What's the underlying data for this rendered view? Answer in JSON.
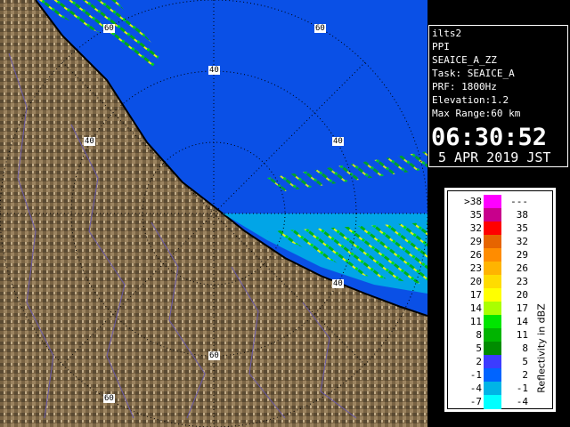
{
  "info": {
    "lines": [
      "ilts2",
      "PPI",
      "SEAICE_A_ZZ",
      "Task: SEAICE_A",
      "PRF: 1800Hz",
      "Elevation:1.2",
      "Max Range:60 km"
    ],
    "time": "06:30:52",
    "date": "5 APR 2019 JST"
  },
  "rings": {
    "labels": [
      "40",
      "40",
      "40",
      "40",
      "60",
      "60",
      "60",
      "60"
    ]
  },
  "legend": {
    "title": "Reflectivity in dBZ",
    "rows": [
      {
        "lo": ">38",
        "hi": "---",
        "color": "#ff00ff"
      },
      {
        "lo": "35",
        "hi": "38",
        "color": "#c8008c"
      },
      {
        "lo": "32",
        "hi": "35",
        "color": "#ff0000"
      },
      {
        "lo": "29",
        "hi": "32",
        "color": "#e66400"
      },
      {
        "lo": "26",
        "hi": "29",
        "color": "#ff8c00"
      },
      {
        "lo": "23",
        "hi": "26",
        "color": "#ffb400"
      },
      {
        "lo": "20",
        "hi": "23",
        "color": "#ffdc00"
      },
      {
        "lo": "17",
        "hi": "20",
        "color": "#ffff00"
      },
      {
        "lo": "14",
        "hi": "17",
        "color": "#aaff00"
      },
      {
        "lo": "11",
        "hi": "14",
        "color": "#00e600"
      },
      {
        "lo": "8",
        "hi": "11",
        "color": "#00b400"
      },
      {
        "lo": "5",
        "hi": "8",
        "color": "#008c00"
      },
      {
        "lo": "2",
        "hi": "5",
        "color": "#3c3cff"
      },
      {
        "lo": "-1",
        "hi": "2",
        "color": "#0064ff"
      },
      {
        "lo": "-4",
        "hi": "-1",
        "color": "#00b4e6"
      },
      {
        "lo": "-7",
        "hi": "-4",
        "color": "#00ffff"
      }
    ]
  },
  "colors": {
    "sea": "#0a50e6",
    "land": "#7a6444",
    "coast": "#000000"
  }
}
